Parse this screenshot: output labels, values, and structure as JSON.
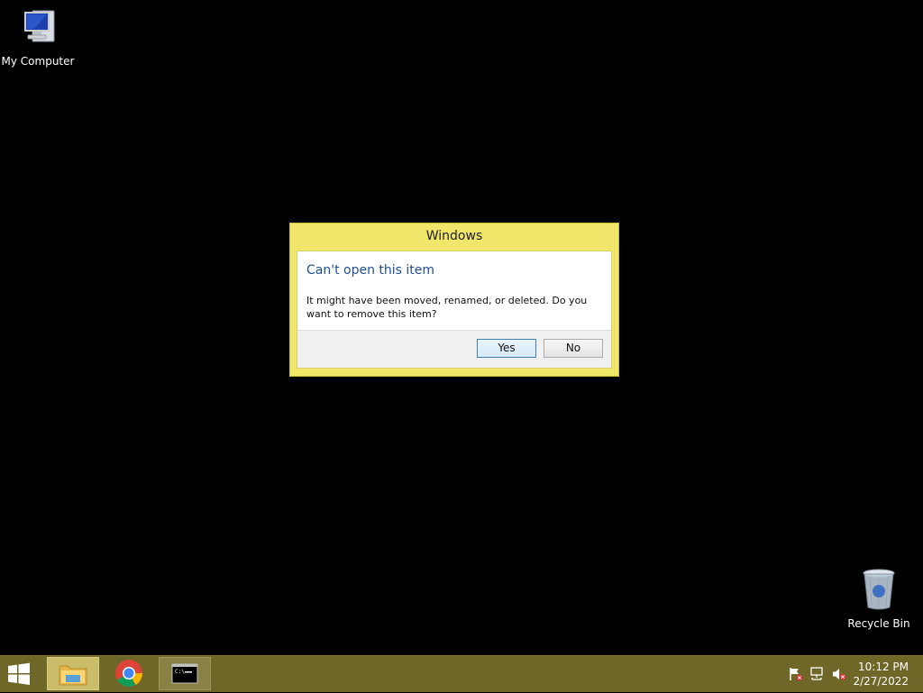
{
  "desktop": {
    "icons": [
      {
        "label": "My Computer",
        "icon": "computer-icon"
      },
      {
        "label": "Recycle Bin",
        "icon": "recycle-bin-icon"
      }
    ]
  },
  "dialog": {
    "title": "Windows",
    "heading": "Can't open this item",
    "message": "It might have been moved, renamed, or deleted. Do you want to remove this item?",
    "buttons": {
      "yes": "Yes",
      "no": "No"
    }
  },
  "taskbar": {
    "start_icon": "windows-logo-icon",
    "tasks": [
      {
        "icon": "file-explorer-icon",
        "state": "active"
      },
      {
        "icon": "chrome-icon",
        "state": "pinned"
      },
      {
        "icon": "command-prompt-icon",
        "state": "running"
      }
    ],
    "tray": {
      "icons": [
        "action-center-flag-icon",
        "network-icon",
        "volume-muted-icon"
      ],
      "time": "10:12 PM",
      "date": "2/27/2022"
    }
  },
  "colors": {
    "window_frame": "#f0e66a",
    "taskbar": "#6f6728",
    "heading_text": "#1e4f97",
    "desktop": "#000000"
  }
}
